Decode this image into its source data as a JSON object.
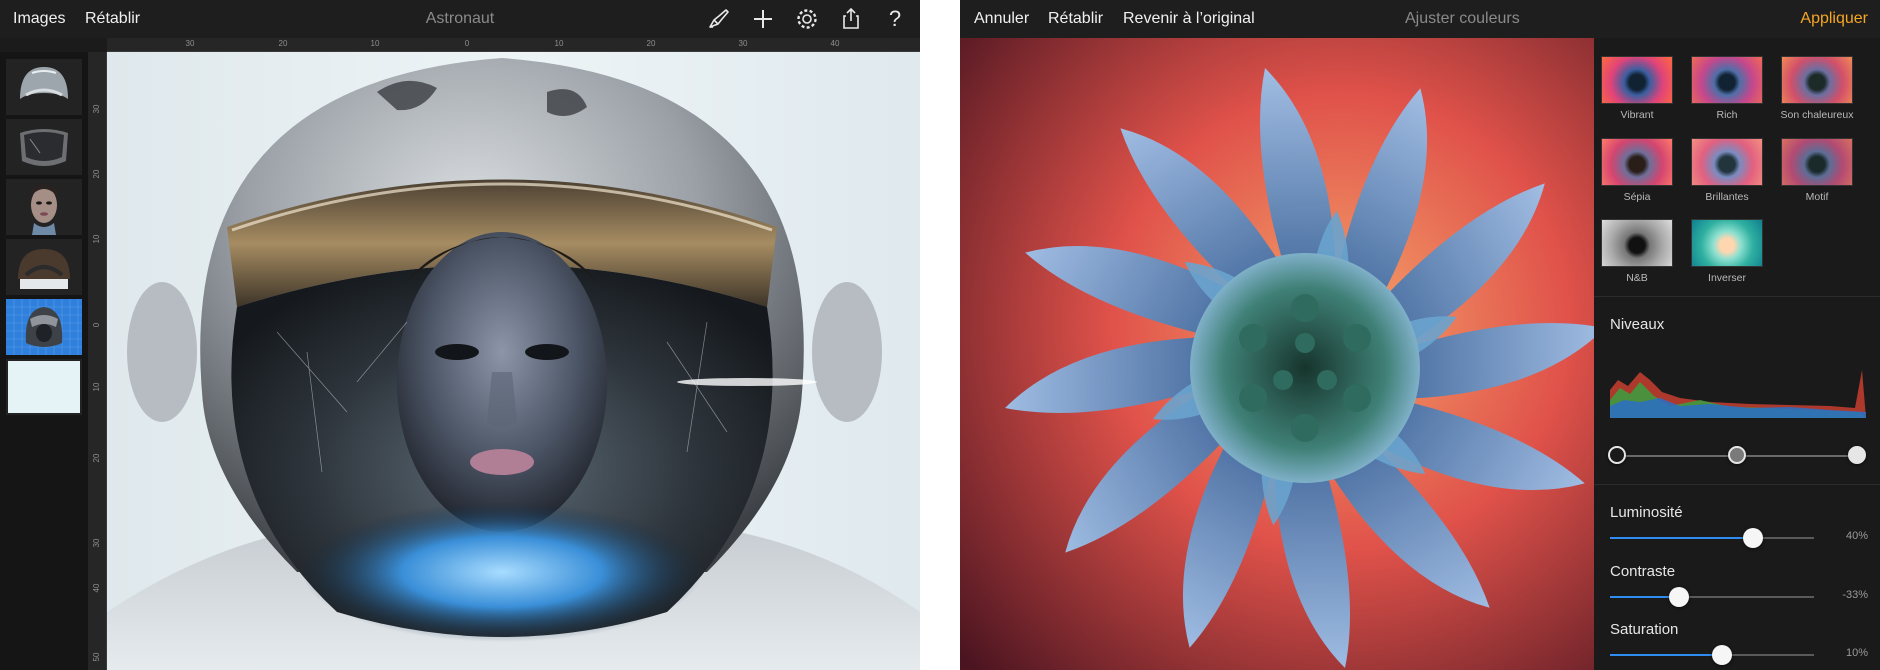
{
  "left_app": {
    "toolbar": {
      "images_label": "Images",
      "redo_label": "Rétablir",
      "title": "Astronaut"
    },
    "icons": [
      "paint-brush-icon",
      "plus-icon",
      "gear-icon",
      "share-icon",
      "help-icon"
    ],
    "help_glyph": "?",
    "ruler": {
      "horizontal": [
        "30",
        "20",
        "10",
        "0",
        "10",
        "20",
        "30",
        "40"
      ],
      "vertical": [
        "30",
        "20",
        "10",
        "0",
        "10",
        "20",
        "30",
        "40",
        "50"
      ]
    },
    "layers": [
      {
        "name": "helmet-top",
        "selected": false
      },
      {
        "name": "visor",
        "selected": false
      },
      {
        "name": "face",
        "selected": false
      },
      {
        "name": "helmet-back",
        "selected": false
      },
      {
        "name": "helmet-grid",
        "selected": true
      },
      {
        "name": "background",
        "selected": false
      }
    ],
    "accent_color": "#2f7fdc"
  },
  "right_app": {
    "toolbar": {
      "cancel_label": "Annuler",
      "redo_label": "Rétablir",
      "revert_label": "Revenir à l’original",
      "title": "Ajuster couleurs",
      "apply_label": "Appliquer"
    },
    "presets": [
      {
        "label": "Vibrant"
      },
      {
        "label": "Rich"
      },
      {
        "label": "Son chaleureux"
      },
      {
        "label": "Sépia"
      },
      {
        "label": "Brillantes"
      },
      {
        "label": "Motif"
      },
      {
        "label": "N&B"
      },
      {
        "label": "Inverser"
      }
    ],
    "levels": {
      "label": "Niveaux"
    },
    "sliders": [
      {
        "label": "Luminosité",
        "value": "40%",
        "level": 0.7
      },
      {
        "label": "Contraste",
        "value": "-33%",
        "level": 0.34
      },
      {
        "label": "Saturation",
        "value": "10%",
        "level": 0.55
      }
    ],
    "apply_color": "#f5a623",
    "slider_color": "#2f8cf0"
  }
}
